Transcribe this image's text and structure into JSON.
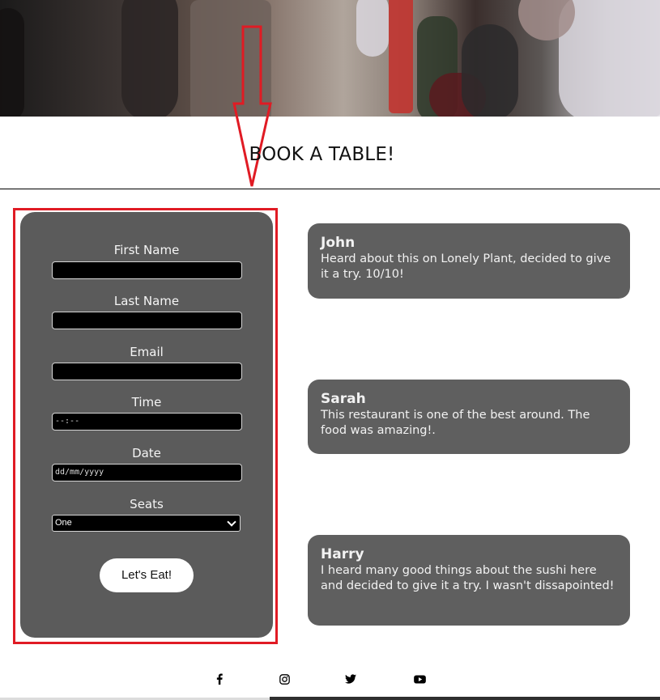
{
  "header": {
    "hero_image": "restaurant-street-photo"
  },
  "page": {
    "title": "BOOK A TABLE!"
  },
  "form": {
    "first_name_label": "First Name",
    "last_name_label": "Last Name",
    "email_label": "Email",
    "time_label": "Time",
    "time_placeholder": "--:--",
    "date_label": "Date",
    "date_placeholder": "dd/mm/yyyy",
    "seats_label": "Seats",
    "seats_value": "One",
    "submit_label": "Let's Eat!"
  },
  "reviews": [
    {
      "name": "John",
      "text": "Heard about this on Lonely Plant, decided to give it a try. 10/10!"
    },
    {
      "name": "Sarah",
      "text": "This restaurant is one of the best around. The food was amazing!."
    },
    {
      "name": "Harry",
      "text": "I heard many good things about the sushi here and decided to give it a try. I wasn't dissapointed!"
    }
  ],
  "footer": {
    "social_icons": [
      "facebook-icon",
      "instagram-icon",
      "twitter-icon",
      "youtube-icon"
    ]
  },
  "colors": {
    "highlight": "#e01b24",
    "card": "#5b5b5b",
    "review_card": "#5f5f5f"
  }
}
